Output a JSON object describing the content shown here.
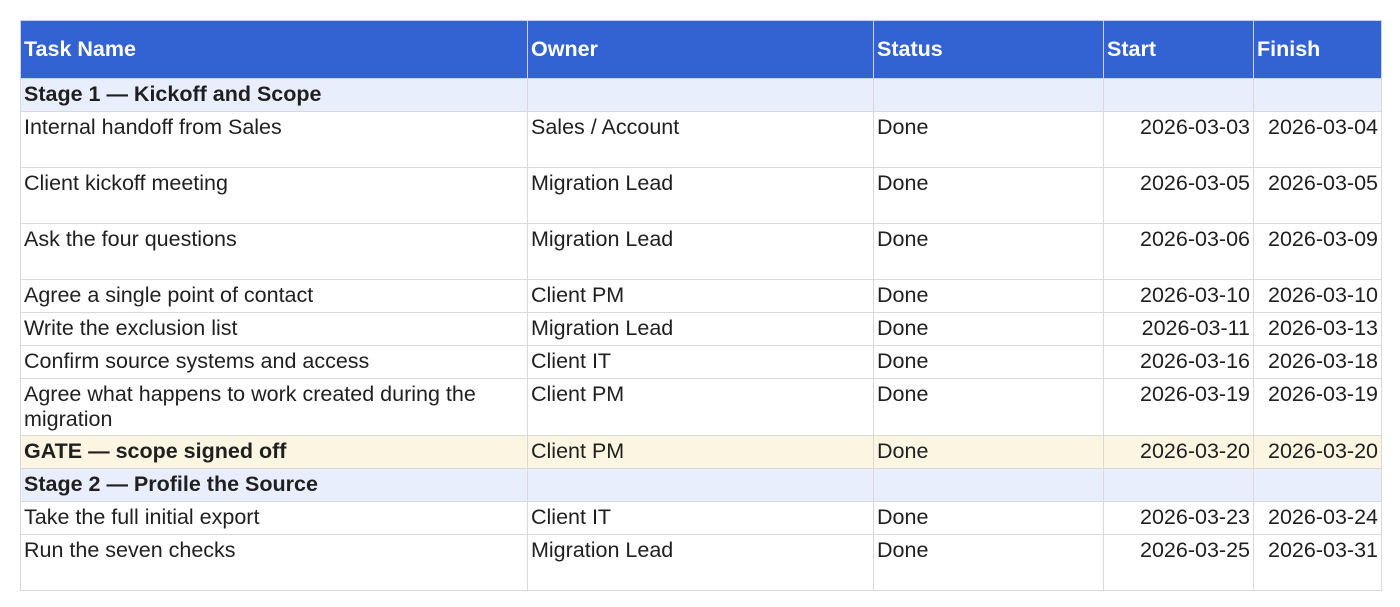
{
  "columns": [
    "Task Name",
    "Owner",
    "Status",
    "Start",
    "Finish"
  ],
  "rows": [
    {
      "type": "stage",
      "task": "Stage 1 — Kickoff and Scope",
      "owner": "",
      "status": "",
      "start": "",
      "finish": ""
    },
    {
      "type": "task",
      "task": "Internal handoff from Sales",
      "owner": "Sales / Account",
      "status": "Done",
      "start": "2026-03-03",
      "finish": "2026-03-04"
    },
    {
      "type": "task",
      "task": "Client kickoff meeting",
      "owner": "Migration Lead",
      "status": "Done",
      "start": "2026-03-05",
      "finish": "2026-03-05"
    },
    {
      "type": "task",
      "task": "Ask the four questions",
      "owner": "Migration Lead",
      "status": "Done",
      "start": "2026-03-06",
      "finish": "2026-03-09"
    },
    {
      "type": "task",
      "task": "Agree a single point of contact",
      "owner": "Client PM",
      "status": "Done",
      "start": "2026-03-10",
      "finish": "2026-03-10"
    },
    {
      "type": "task",
      "task": "Write the exclusion list",
      "owner": "Migration Lead",
      "status": "Done",
      "start": "2026-03-11",
      "finish": "2026-03-13"
    },
    {
      "type": "task",
      "task": "Confirm source systems and access",
      "owner": "Client IT",
      "status": "Done",
      "start": "2026-03-16",
      "finish": "2026-03-18"
    },
    {
      "type": "task",
      "task": "Agree what happens to work created during the migration",
      "owner": "Client PM",
      "status": "Done",
      "start": "2026-03-19",
      "finish": "2026-03-19"
    },
    {
      "type": "gate",
      "task": "GATE — scope signed off",
      "owner": "Client PM",
      "status": "Done",
      "start": "2026-03-20",
      "finish": "2026-03-20"
    },
    {
      "type": "stage",
      "task": "Stage 2 — Profile the Source",
      "owner": "",
      "status": "",
      "start": "",
      "finish": ""
    },
    {
      "type": "task",
      "task": "Take the full initial export",
      "owner": "Client IT",
      "status": "Done",
      "start": "2026-03-23",
      "finish": "2026-03-24"
    },
    {
      "type": "task",
      "task": "Run the seven checks",
      "owner": "Migration Lead",
      "status": "Done",
      "start": "2026-03-25",
      "finish": "2026-03-31"
    }
  ],
  "colors": {
    "header_bg": "#3362d3",
    "header_text": "#ffffff",
    "stage_bg": "#e8eefb",
    "gate_bg": "#fcf5e2",
    "grid": "#d9d9d9"
  }
}
